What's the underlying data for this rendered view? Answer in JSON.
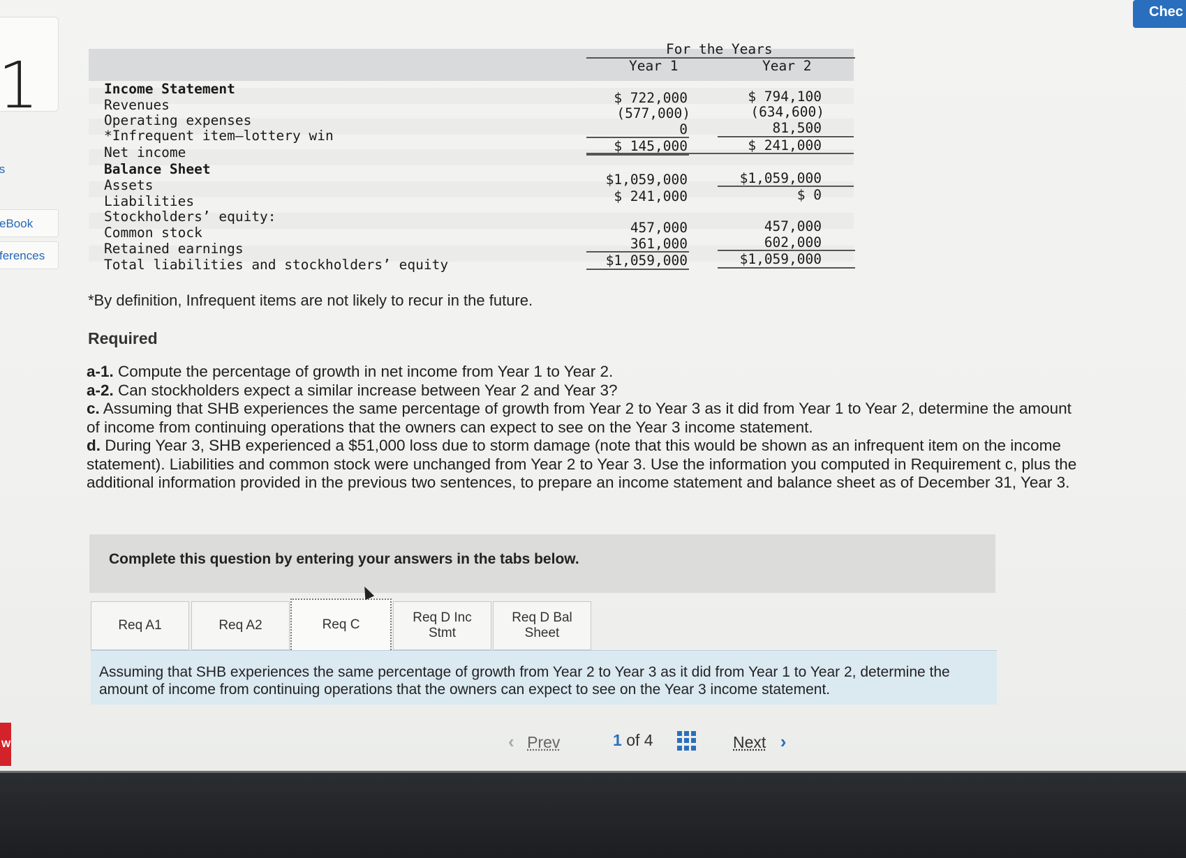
{
  "page": {
    "question_number": "1",
    "check_label": "Chec",
    "nav": {
      "item_ts": "ts",
      "item_ebook": "eBook",
      "item_references": "ferences",
      "red_tab": "W"
    }
  },
  "statement": {
    "header_for_years": "For the Years",
    "year1_label": "Year 1",
    "year2_label": "Year 2",
    "income_statement_label": "Income Statement",
    "revenues_label": "Revenues",
    "operating_expenses_label": "Operating expenses",
    "infrequent_label": "*Infrequent item—lottery win",
    "net_income_label": "Net income",
    "balance_sheet_label": "Balance Sheet",
    "assets_label": "Assets",
    "liabilities_label": "Liabilities",
    "stockholders_equity_label": "Stockholders’ equity:",
    "common_stock_label": "Common stock",
    "retained_earnings_label": "Retained earnings",
    "total_label": "Total liabilities and stockholders’ equity",
    "year1": {
      "revenues": "$ 722,000",
      "operating_expenses": "(577,000)",
      "infrequent": "0",
      "net_income": "$ 145,000",
      "assets": "$1,059,000",
      "liabilities": "$ 241,000",
      "common_stock": "457,000",
      "retained_earnings": "361,000",
      "total": "$1,059,000"
    },
    "year2": {
      "revenues": "$ 794,100",
      "operating_expenses": "(634,600)",
      "infrequent": "81,500",
      "net_income": "$ 241,000",
      "assets": "$1,059,000",
      "liabilities": "$ 0",
      "common_stock": "457,000",
      "retained_earnings": "602,000",
      "total": "$1,059,000"
    }
  },
  "footnote": "*By definition, Infrequent items are not likely to recur in the future.",
  "required_heading": "Required",
  "requirements": {
    "a1_tag": "a-1.",
    "a1_text": " Compute the percentage of growth in net income from Year 1 to Year 2.",
    "a2_tag": "a-2.",
    "a2_text": " Can stockholders expect a similar increase between Year 2 and Year 3?",
    "c_tag": "c.",
    "c_text": " Assuming that SHB experiences the same percentage of growth from Year 2 to Year 3 as it did from Year 1 to Year 2, determine the amount of income from continuing operations that the owners can expect to see on the Year 3 income statement.",
    "d_tag": "d.",
    "d_text": " During Year 3, SHB experienced a $51,000 loss due to storm damage (note that this would be shown as an infrequent item on the income statement). Liabilities and common stock were unchanged from Year 2 to Year 3. Use the information you computed in Requirement c, plus the additional information provided in the previous two sentences, to prepare an income statement and balance sheet as of December 31, Year 3."
  },
  "instructions": "Complete this question by entering your answers in the tabs below.",
  "tabs": {
    "req_a1": "Req A1",
    "req_a2": "Req A2",
    "req_c": "Req C",
    "req_d_inc_line1": "Req D Inc",
    "req_d_inc_line2": "Stmt",
    "req_d_bal_line1": "Req D Bal",
    "req_d_bal_line2": "Sheet"
  },
  "tab_panel_text": "Assuming that SHB experiences the same percentage of growth from Year 2 to Year 3 as it did from Year 1 to Year 2, determine the amount of income from continuing operations that the owners can expect to see on the Year 3 income statement.",
  "pager": {
    "prev_label": "Prev",
    "next_label": "Next",
    "current": "1",
    "of": "of",
    "total": "4"
  }
}
